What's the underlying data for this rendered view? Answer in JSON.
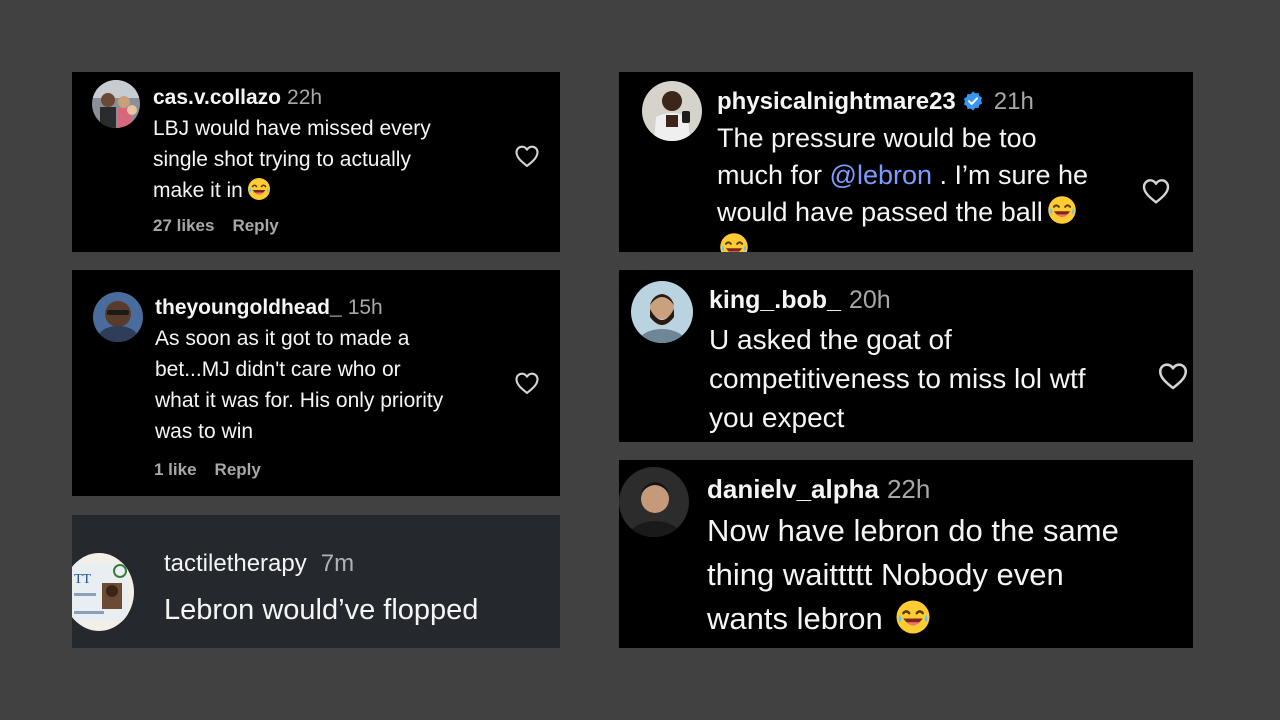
{
  "comments": [
    {
      "username": "cas.v.collazo",
      "time": "22h",
      "lines": [
        "LBJ would have missed every",
        "single shot trying to actually",
        "make it in"
      ],
      "emoji": "laughing-emoji",
      "likes": "27 likes",
      "reply": "Reply"
    },
    {
      "username": "theyoungoldhead_",
      "time": "15h",
      "lines": [
        "As soon as it got to made a",
        "bet...MJ didn't care who or",
        "what it was for. His only priority",
        "was to win"
      ],
      "likes": "1 like",
      "reply": "Reply"
    },
    {
      "username": "tactiletherapy",
      "time": "7m",
      "text": "Lebron would’ve flopped"
    },
    {
      "username": "physicalnightmare23",
      "verified": true,
      "time": "21h",
      "line1": "The pressure would be too",
      "line2_pre": "much for ",
      "mention": "@lebron",
      "line2_post": " . I’m sure he",
      "line3": "would have passed the ball",
      "emoji": "laughing-emoji"
    },
    {
      "username": "king_.bob_",
      "time": "20h",
      "lines": [
        "U asked the goat of",
        "competitiveness to miss lol wtf",
        "you expect"
      ]
    },
    {
      "username": "danielv_alpha",
      "time": "22h",
      "lines": [
        "Now have lebron do the same",
        "thing waittttt Nobody even",
        "wants lebron"
      ],
      "emoji": "laughing-emoji"
    }
  ],
  "colors": {
    "background": "#414141",
    "card": "#000000",
    "card_dark": "#25292e",
    "muted": "#a8a8a8",
    "mention": "#7d9cff",
    "verified": "#3797f0"
  }
}
